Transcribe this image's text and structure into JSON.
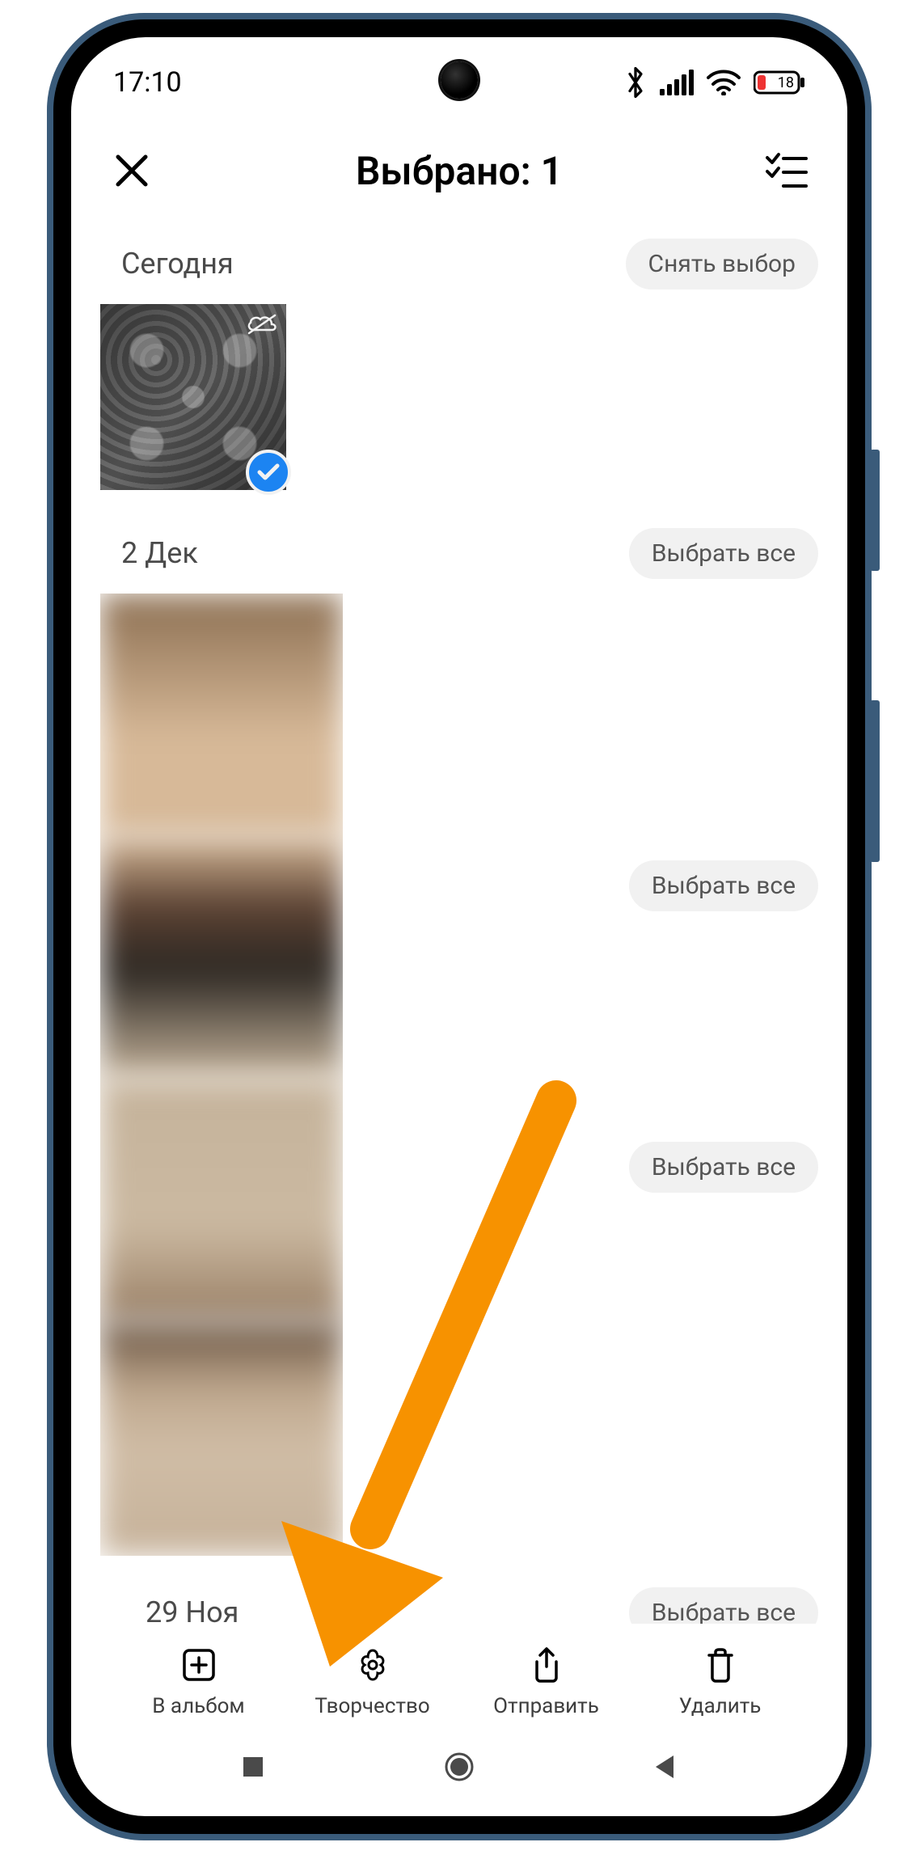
{
  "status": {
    "time": "17:10",
    "battery_text": "18",
    "icon_bluetooth": "bluetooth",
    "icon_signal": "signal",
    "icon_wifi": "wifi",
    "icon_battery": "battery_low"
  },
  "header": {
    "close_icon": "close",
    "title": "Выбрано: 1",
    "select_icon": "select-all"
  },
  "sections": [
    {
      "date": "Сегодня",
      "pill": "Снять выбор",
      "selected": true
    },
    {
      "date": "2 Дек",
      "pill": "Выбрать все"
    },
    {
      "date": "",
      "pill": "Выбрать все"
    },
    {
      "date": "",
      "pill": "Выбрать все"
    },
    {
      "date": "29 Ноя",
      "pill": "Выбрать все"
    }
  ],
  "actions": [
    {
      "label": "В альбом",
      "icon": "add-square"
    },
    {
      "label": "Творчество",
      "icon": "flower"
    },
    {
      "label": "Отправить",
      "icon": "share"
    },
    {
      "label": "Удалить",
      "icon": "trash"
    }
  ],
  "nav": {
    "recent": "square",
    "home": "circle",
    "back": "triangle-left"
  }
}
